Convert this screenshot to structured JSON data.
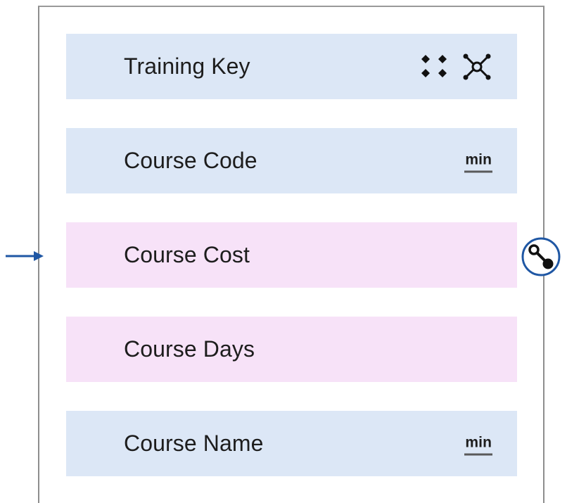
{
  "entity": {
    "attributes": [
      {
        "label": "Training Key",
        "kind": "key",
        "icons": [
          "key-attribute-icon",
          "relationship-node-icon"
        ]
      },
      {
        "label": "Course Code",
        "kind": "regular",
        "badge": "min"
      },
      {
        "label": "Course Cost",
        "kind": "measure"
      },
      {
        "label": "Course Days",
        "kind": "measure"
      },
      {
        "label": "Course Name",
        "kind": "regular",
        "badge": "min"
      }
    ]
  },
  "colors": {
    "attribute_row": "#dce7f6",
    "measure_row": "#f7e2f8",
    "connector": "#1f57a4"
  }
}
